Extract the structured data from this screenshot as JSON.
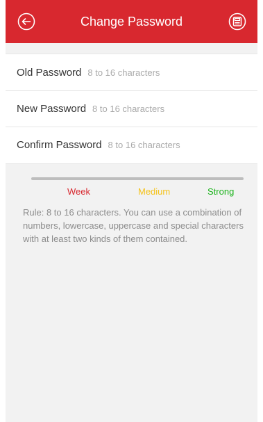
{
  "header": {
    "title": "Change Password",
    "back_icon": "back-arrow-circle-icon",
    "save_icon": "save-icon",
    "color": "#d8282f"
  },
  "form": {
    "fields": [
      {
        "label": "Old Password",
        "placeholder": "8 to 16 characters",
        "value": ""
      },
      {
        "label": "New Password",
        "placeholder": "8 to 16 characters",
        "value": ""
      },
      {
        "label": "Confirm Password",
        "placeholder": "8 to 16 characters",
        "value": ""
      }
    ]
  },
  "strength": {
    "levels": [
      {
        "label": "Week",
        "color": "#d8282f"
      },
      {
        "label": "Medium",
        "color": "#f5c31b"
      },
      {
        "label": "Strong",
        "color": "#1bb31b"
      }
    ],
    "rule": "Rule: 8 to 16 characters. You can use a combination of numbers, lowercase, uppercase and special characters with at least two kinds of them contained."
  }
}
